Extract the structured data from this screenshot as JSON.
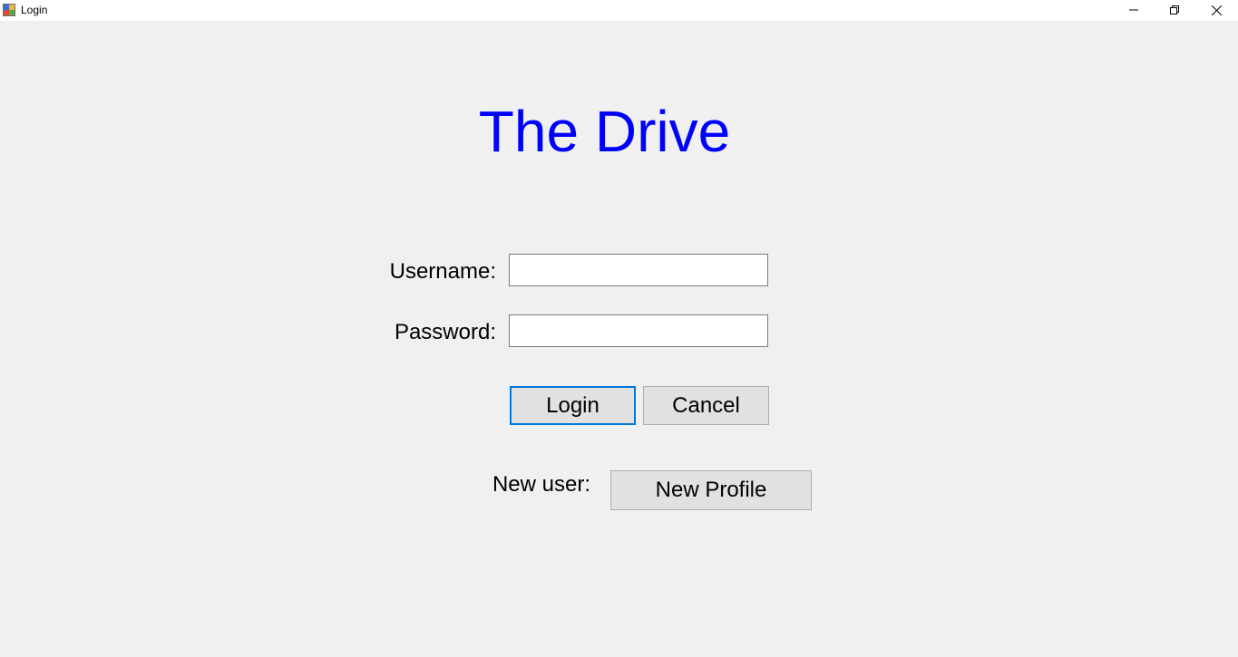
{
  "window": {
    "title": "Login",
    "icon": "app-form-icon",
    "controls": [
      "minimize-icon",
      "restore-icon",
      "close-icon"
    ]
  },
  "form": {
    "title": "The Drive",
    "title_color": "#0000ff",
    "username_label": "Username:",
    "username_value": "",
    "password_label": "Password:",
    "password_value": "",
    "login_label": "Login",
    "cancel_label": "Cancel",
    "new_user_label": "New user:",
    "new_profile_label": "New Profile"
  },
  "colors": {
    "background": "#f0f0f0",
    "button_face": "#e1e1e1",
    "focus_border": "#0078d7"
  }
}
